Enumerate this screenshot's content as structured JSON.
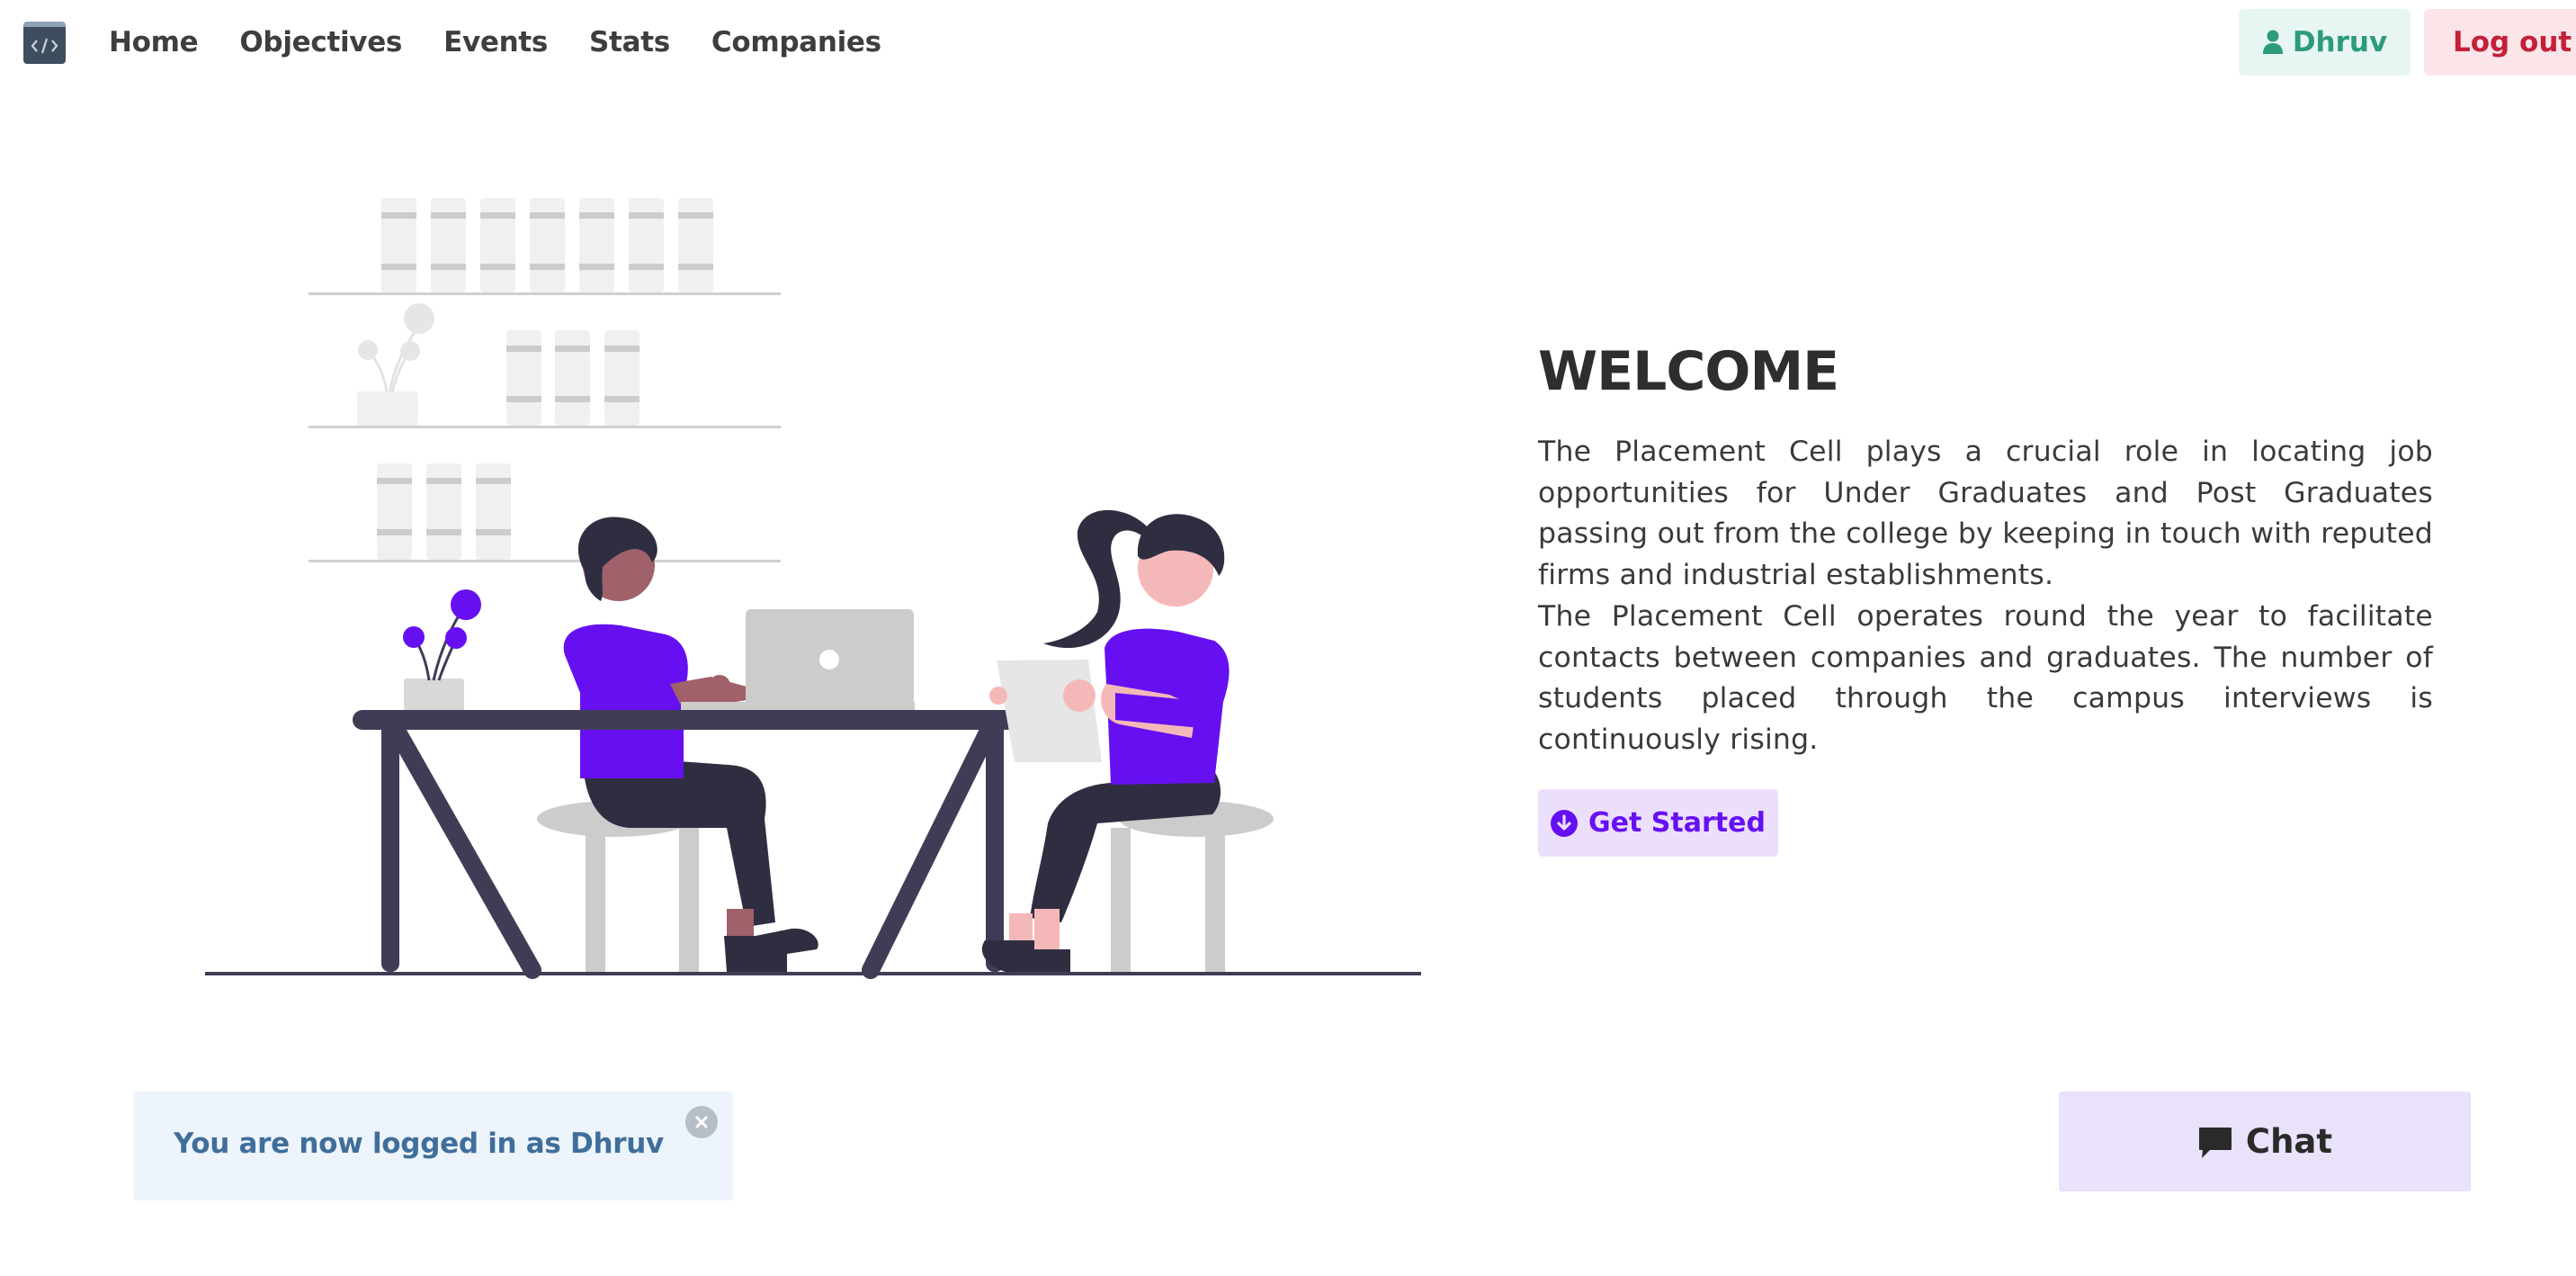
{
  "nav": {
    "links": [
      {
        "label": "Home"
      },
      {
        "label": "Objectives"
      },
      {
        "label": "Events"
      },
      {
        "label": "Stats"
      },
      {
        "label": "Companies"
      }
    ],
    "user_label": "Dhruv",
    "logout_label": "Log out"
  },
  "hero": {
    "title": "WELCOME",
    "paragraph1": "The Placement Cell plays a crucial role in locating job opportunities for Under Graduates and Post Graduates passing out from the college by keeping in touch with reputed firms and industrial establishments.",
    "paragraph2": "The Placement Cell operates round the year to facilitate contacts between companies and graduates. The number of students placed through the campus interviews is continuously rising.",
    "cta_label": "Get Started"
  },
  "alert": {
    "message": "You are now logged in as Dhruv"
  },
  "chat": {
    "label": "Chat"
  },
  "colors": {
    "accent": "#6610f2",
    "user_green": "#2d9a7c",
    "logout_red": "#c3203a",
    "alert_blue": "#3f6e9b"
  },
  "icons": [
    "code-logo-icon",
    "user-icon",
    "arrow-circle-down-icon",
    "close-icon",
    "comment-icon"
  ]
}
